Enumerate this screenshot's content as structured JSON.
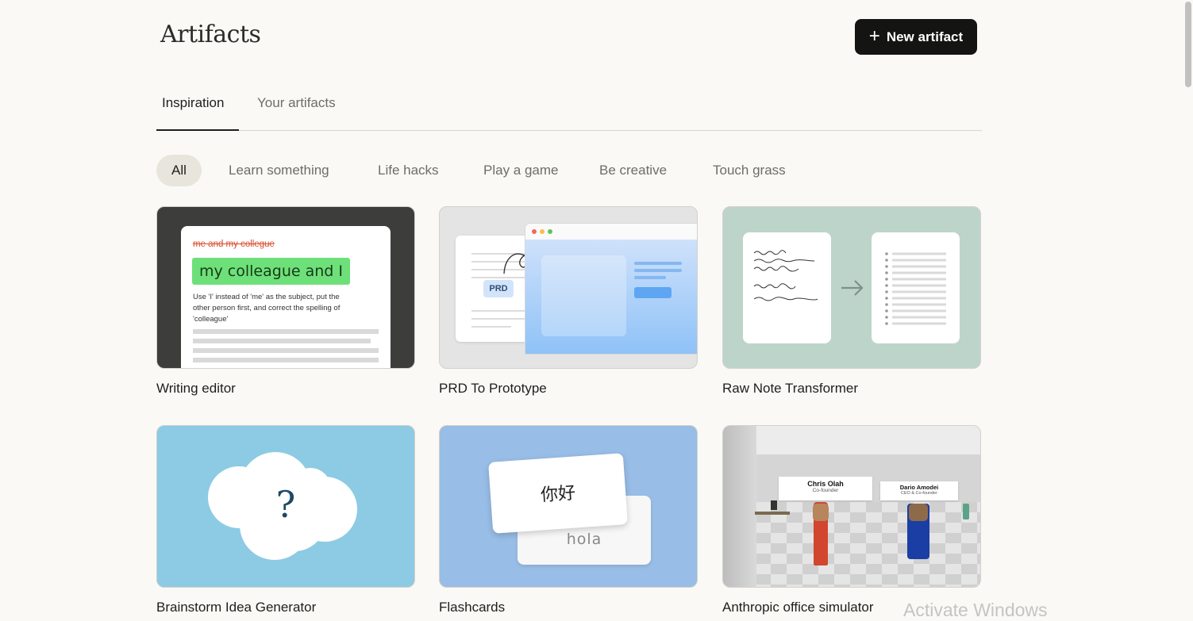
{
  "header": {
    "title": "Artifacts",
    "new_button_label": "New artifact"
  },
  "tabs": [
    {
      "label": "Inspiration",
      "active": true
    },
    {
      "label": "Your artifacts",
      "active": false
    }
  ],
  "filters": [
    {
      "label": "All",
      "active": true
    },
    {
      "label": "Learn something",
      "active": false
    },
    {
      "label": "Life hacks",
      "active": false
    },
    {
      "label": "Play a game",
      "active": false
    },
    {
      "label": "Be creative",
      "active": false
    },
    {
      "label": "Touch grass",
      "active": false
    }
  ],
  "cards": [
    {
      "label": "Writing editor",
      "preview": {
        "struck": "me and my collegue",
        "corrected": "my colleague and I",
        "note_lines": [
          "Use 'I' instead of 'me' as the subject, put the",
          "other person first, and correct the spelling of",
          "'colleague'"
        ]
      }
    },
    {
      "label": "PRD To Prototype",
      "preview": {
        "badge": "PRD"
      }
    },
    {
      "label": "Raw Note Transformer"
    },
    {
      "label": "Brainstorm Idea Generator",
      "preview": {
        "glyph": "?"
      }
    },
    {
      "label": "Flashcards",
      "preview": {
        "front": "你好",
        "back": "hola"
      }
    },
    {
      "label": "Anthropic office simulator",
      "preview": {
        "sign1_name": "Chris Olah",
        "sign1_role": "Co-founder",
        "sign2_name": "Dario Amodei",
        "sign2_role": "CEO & Co-founder"
      }
    }
  ],
  "colors": {
    "accent_green": "#6ee07a",
    "strike_red": "#d94a2b",
    "dark_button": "#141413"
  },
  "watermark": "Activate Windows"
}
